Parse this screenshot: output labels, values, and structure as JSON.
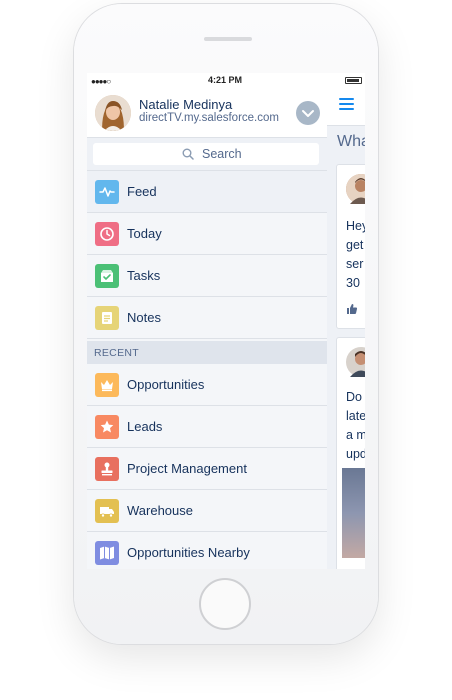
{
  "status": {
    "time": "4:21 PM",
    "signal": "●●●●○"
  },
  "profile": {
    "name": "Natalie Medinya",
    "domain": "directTV.my.salesforce.com"
  },
  "search": {
    "label": "Search"
  },
  "menu": {
    "items": [
      {
        "label": "Feed",
        "icon": "feed-icon",
        "color": "#62b7ed"
      },
      {
        "label": "Today",
        "icon": "clock-icon",
        "color": "#ef6e85"
      },
      {
        "label": "Tasks",
        "icon": "tasks-icon",
        "color": "#4bc076"
      },
      {
        "label": "Notes",
        "icon": "notes-icon",
        "color": "#e6d478"
      }
    ],
    "recent_header": "RECENT",
    "recent": [
      {
        "label": "Opportunities",
        "icon": "crown-icon",
        "color": "#fcb95b"
      },
      {
        "label": "Leads",
        "icon": "star-icon",
        "color": "#f88962"
      },
      {
        "label": "Project Management",
        "icon": "stamp-icon",
        "color": "#e8705f"
      },
      {
        "label": "Warehouse",
        "icon": "truck-icon",
        "color": "#e3c052"
      },
      {
        "label": "Opportunities Nearby",
        "icon": "map-icon",
        "color": "#7f8de1"
      }
    ]
  },
  "feed": {
    "title": "Wha",
    "post1": {
      "lines": [
        "Hey",
        "get",
        "ser",
        "30"
      ]
    },
    "post2": {
      "lines": [
        "Do",
        "late",
        "a m",
        "upd"
      ]
    }
  },
  "colors": {
    "accent": "#1589ee",
    "text_primary": "#16325c",
    "text_secondary": "#54698d"
  }
}
